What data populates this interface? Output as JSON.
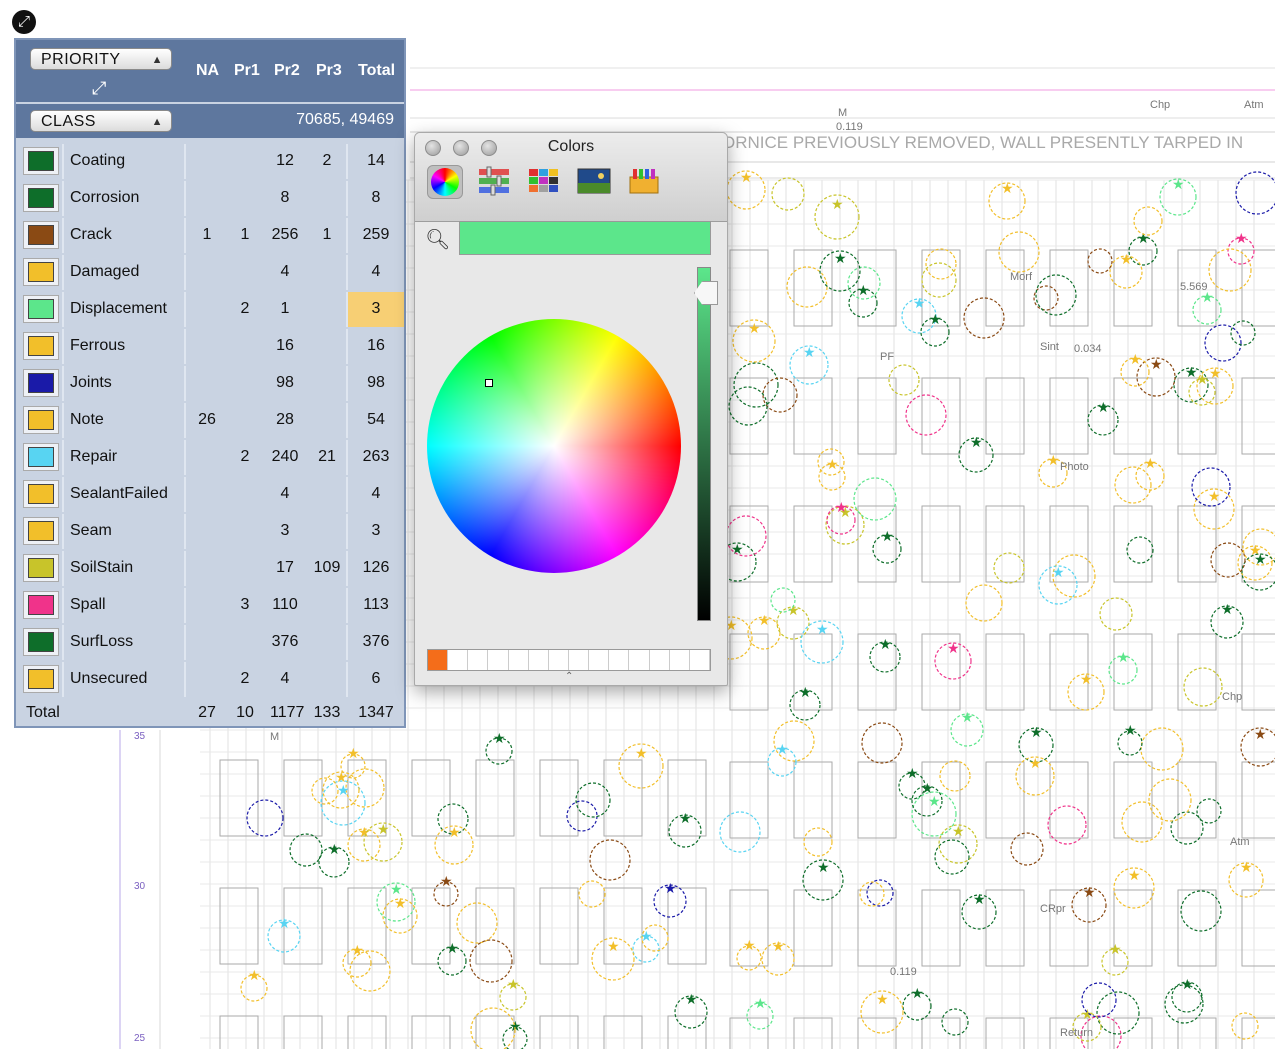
{
  "drawing": {
    "banner_text": "ORNICE PREVIOUSLY REMOVED, WALL PRESENTLY TARPED IN",
    "scale_labels": [
      "35",
      "30",
      "25"
    ],
    "sample_tags": [
      "M",
      "0.119",
      "Chp",
      "Atm",
      "Morf",
      "Sint",
      "PF",
      "Photo",
      "CRpr",
      "Return",
      "0.034",
      "5.569"
    ]
  },
  "panel": {
    "priority_label": "PRIORITY",
    "class_label": "CLASS",
    "class_summary": "70685, 49469",
    "columns": [
      "NA",
      "Pr1",
      "Pr2",
      "Pr3",
      "Total"
    ],
    "rows": [
      {
        "name": "Coating",
        "color": "#0e6e2a",
        "na": "",
        "pr1": "",
        "pr2": "12",
        "pr3": "2",
        "total": "14"
      },
      {
        "name": "Corrosion",
        "color": "#0e6e2a",
        "na": "",
        "pr1": "",
        "pr2": "8",
        "pr3": "",
        "total": "8"
      },
      {
        "name": "Crack",
        "color": "#8a4a14",
        "na": "1",
        "pr1": "1",
        "pr2": "256",
        "pr3": "1",
        "total": "259"
      },
      {
        "name": "Damaged",
        "color": "#f2bf2a",
        "na": "",
        "pr1": "",
        "pr2": "4",
        "pr3": "",
        "total": "4"
      },
      {
        "name": "Displacement",
        "color": "#5ce68b",
        "na": "",
        "pr1": "2",
        "pr2": "1",
        "pr3": "",
        "total": "3"
      },
      {
        "name": "Ferrous",
        "color": "#f2bf2a",
        "na": "",
        "pr1": "",
        "pr2": "16",
        "pr3": "",
        "total": "16"
      },
      {
        "name": "Joints",
        "color": "#1a1aa8",
        "na": "",
        "pr1": "",
        "pr2": "98",
        "pr3": "",
        "total": "98"
      },
      {
        "name": "Note",
        "color": "#f2bf2a",
        "na": "26",
        "pr1": "",
        "pr2": "28",
        "pr3": "",
        "total": "54"
      },
      {
        "name": "Repair",
        "color": "#58d4f2",
        "na": "",
        "pr1": "2",
        "pr2": "240",
        "pr3": "21",
        "total": "263"
      },
      {
        "name": "SealantFailed",
        "color": "#f2bf2a",
        "na": "",
        "pr1": "",
        "pr2": "4",
        "pr3": "",
        "total": "4"
      },
      {
        "name": "Seam",
        "color": "#f2bf2a",
        "na": "",
        "pr1": "",
        "pr2": "3",
        "pr3": "",
        "total": "3"
      },
      {
        "name": "SoilStain",
        "color": "#c8c42a",
        "na": "",
        "pr1": "",
        "pr2": "17",
        "pr3": "109",
        "total": "126"
      },
      {
        "name": "Spall",
        "color": "#f0338a",
        "na": "",
        "pr1": "3",
        "pr2": "110",
        "pr3": "",
        "total": "113"
      },
      {
        "name": "SurfLoss",
        "color": "#0e6e2a",
        "na": "",
        "pr1": "",
        "pr2": "376",
        "pr3": "",
        "total": "376"
      },
      {
        "name": "Unsecured",
        "color": "#f2bf2a",
        "na": "",
        "pr1": "2",
        "pr2": "4",
        "pr3": "",
        "total": "6"
      }
    ],
    "total_row": {
      "label": "Total",
      "na": "27",
      "pr1": "10",
      "pr2": "1177",
      "pr3": "133",
      "total": "1347"
    },
    "highlighted_row": "Displacement"
  },
  "colors_window": {
    "title": "Colors",
    "selected_color": "#5ce68b",
    "swatch_first": "#f46d1a",
    "modes": [
      "color-wheel",
      "color-sliders",
      "color-palettes",
      "image-palettes",
      "crayons"
    ]
  }
}
